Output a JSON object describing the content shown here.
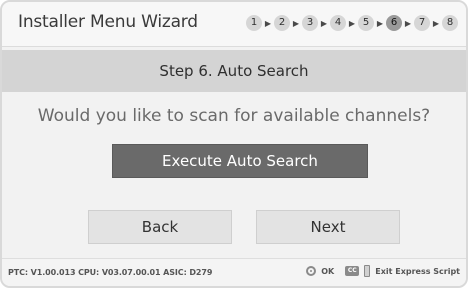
{
  "header": {
    "title": "Installer Menu Wizard",
    "steps": [
      "1",
      "2",
      "3",
      "4",
      "5",
      "6",
      "7",
      "8"
    ],
    "active_step": 6
  },
  "subheader": {
    "step_title": "Step 6. Auto Search"
  },
  "main": {
    "question": "Would you like to scan for available channels?",
    "execute_label": "Execute Auto Search",
    "back_label": "Back",
    "next_label": "Next"
  },
  "footer": {
    "versions": "PTC: V1.00.013 CPU: V03.07.00.01 ASIC: D279",
    "ok_label": "OK",
    "cc_label": "CC",
    "exit_label": "Exit Express Script"
  },
  "colors": {
    "frame_bg": "#f2f2f2",
    "subheader_bg": "#d4d4d4",
    "primary_button_bg": "#6a6a6a",
    "nav_button_bg": "#e3e3e3",
    "active_step_bg": "#9a9a9a"
  },
  "icons": {
    "step_arrow": "right-triangle-icon",
    "ok": "ok-circle-icon",
    "cc": "cc-icon",
    "exit": "exit-icon"
  }
}
